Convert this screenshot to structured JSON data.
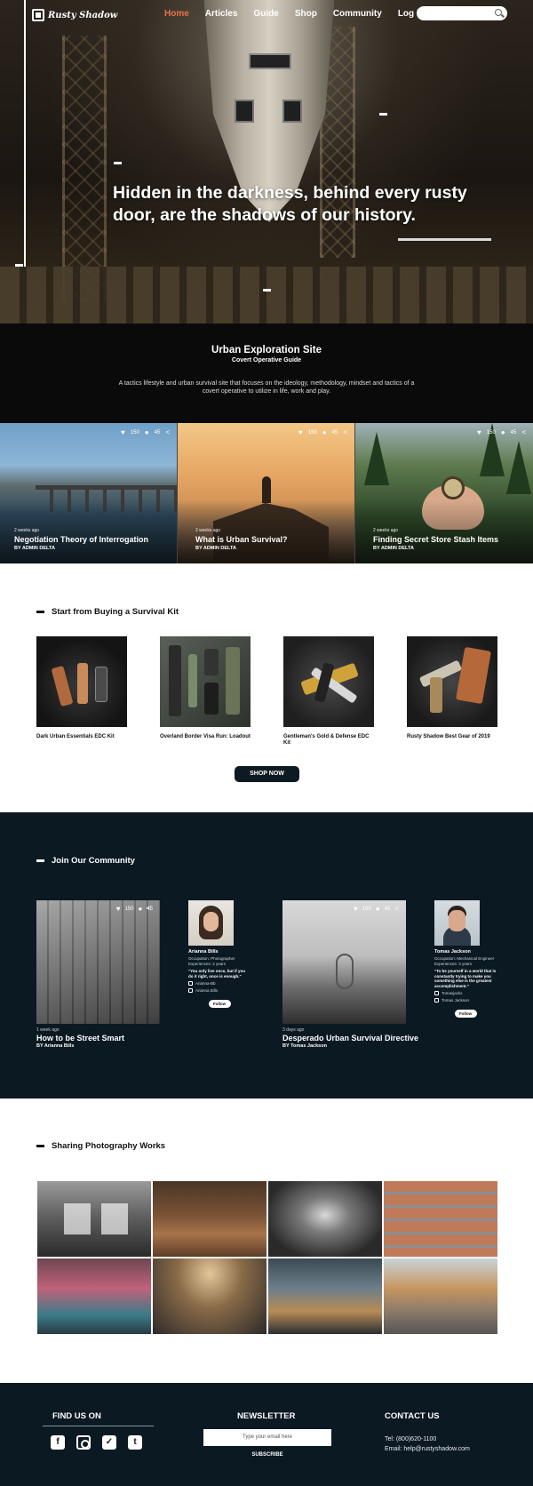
{
  "nav": {
    "logo_text": "Rusty Shadow",
    "menu": [
      "Home",
      "Articles",
      "Guide",
      "Shop",
      "Community",
      "Log in"
    ],
    "search_placeholder": ""
  },
  "hero": {
    "headline": "Hidden in the darkness, behind every rusty door, are the shadows of our history."
  },
  "intro": {
    "title": "Urban Exploration Site",
    "subtitle": "Covert Operative Guide",
    "description": "A tactics lifestyle and urban survival site that focuses on the ideology, methodology, mindset and tactics of a covert operative to utilize in life, work and play."
  },
  "featured": [
    {
      "meta": "2 weeks ago",
      "title": "Negotiation Theory of Interrogation",
      "by": "BY ADMIN DELTA",
      "likes": "150",
      "comments": "45"
    },
    {
      "meta": "2 weeks ago",
      "title": "What is Urban Survival?",
      "by": "BY ADMIN DELTA",
      "likes": "150",
      "comments": "45"
    },
    {
      "meta": "2 weeks ago",
      "title": "Finding Secret Store Stash Items",
      "by": "BY ADMIN DELTA",
      "likes": "150",
      "comments": "45"
    }
  ],
  "shop": {
    "heading": "Start from Buying a Survival Kit",
    "items": [
      "Dark Urban Essentials EDC Kit",
      "Overland Border Visa Run: Loadout",
      "Gentleman's Gold & Defense EDC Kit",
      "Rusty Shadow Best Gear of 2019"
    ],
    "button": "SHOP NOW"
  },
  "community": {
    "heading": "Join Our Community",
    "posts": [
      {
        "meta": "1 week ago",
        "title": "How to be Street Smart",
        "by": "BY Arianna Bills",
        "likes": "150",
        "comments": "45"
      },
      {
        "meta": "3 days ago",
        "title": "Desperado Urban Survival Directive",
        "by": "BY Tomas Jackson",
        "likes": "150",
        "comments": "45"
      }
    ],
    "profiles": [
      {
        "name": "Arianna Bills",
        "occupation": "Occupation: Photographer",
        "experience": "Experiences: 2 years",
        "quote": "\"You only live once, but if you do it right, once is enough.\"",
        "instagram": "Arianna-Bb",
        "facebook": "Arianna Bills",
        "follow": "Follow"
      },
      {
        "name": "Tomas Jackson",
        "occupation": "Occupation: Mechanical Engineer",
        "experience": "Experiences: 3 years",
        "quote": "\"To be yourself in a world that is constantly trying to make you something else is the greatest accomplishment.\"",
        "instagram": "Tomasjacks",
        "facebook": "Tomas Jackson",
        "follow": "Follow"
      }
    ]
  },
  "gallery": {
    "heading": "Sharing Photography Works"
  },
  "footer": {
    "find_heading": "FIND US ON",
    "social": [
      "facebook-icon",
      "instagram-icon",
      "twitter-icon",
      "tumblr-icon"
    ],
    "newsletter_heading": "NEWSLETTER",
    "email_placeholder": "Type your email here",
    "subscribe": "SUBSCRIBE",
    "contact_heading": "CONTACT US",
    "tel": "Tel: (800)620-1100",
    "email": "Email: help@rustyshadow.com"
  },
  "colors": {
    "accent": "#e8734a",
    "dark_navy": "#0b1923",
    "intro_bg": "#0a0a0a"
  }
}
